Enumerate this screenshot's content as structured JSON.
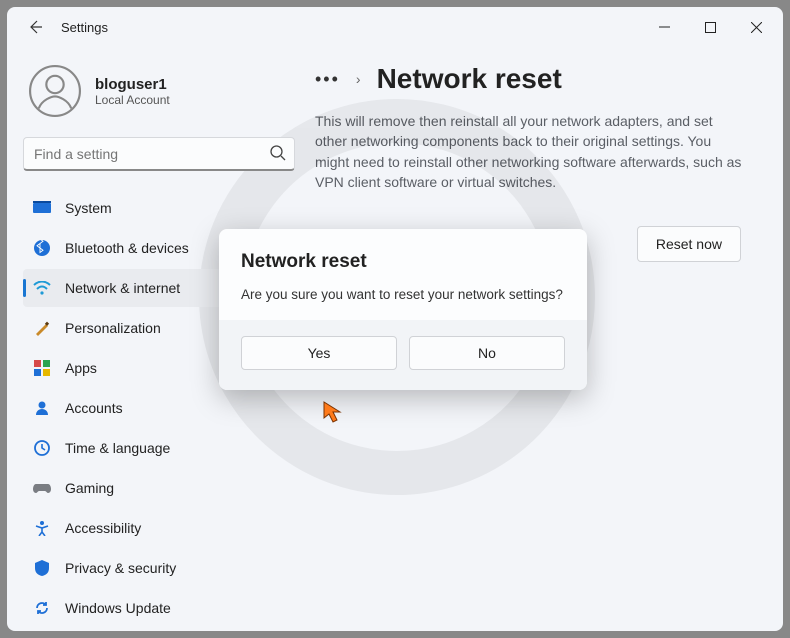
{
  "app_title": "Settings",
  "user": {
    "name": "bloguser1",
    "sub": "Local Account"
  },
  "search": {
    "placeholder": "Find a setting"
  },
  "sidebar": {
    "items": [
      {
        "label": "System"
      },
      {
        "label": "Bluetooth & devices"
      },
      {
        "label": "Network & internet"
      },
      {
        "label": "Personalization"
      },
      {
        "label": "Apps"
      },
      {
        "label": "Accounts"
      },
      {
        "label": "Time & language"
      },
      {
        "label": "Gaming"
      },
      {
        "label": "Accessibility"
      },
      {
        "label": "Privacy & security"
      },
      {
        "label": "Windows Update"
      }
    ],
    "selected_index": 2
  },
  "main": {
    "title": "Network reset",
    "description": "This will remove then reinstall all your network adapters, and set other networking components back to their original settings. You might need to reinstall other networking software afterwards, such as VPN client software or virtual switches.",
    "reset_button": "Reset now"
  },
  "dialog": {
    "title": "Network reset",
    "message": "Are you sure you want to reset your network settings?",
    "yes": "Yes",
    "no": "No"
  },
  "icons": {
    "system_color": "#1e6fd6",
    "bluetooth_color": "#1e6fd6",
    "network_color": "#1e9ad6",
    "personal_color": "#c98a2a",
    "apps_colors": [
      "#d64a4a",
      "#2aa34f",
      "#1e6fd6",
      "#e6b800"
    ],
    "accounts_color": "#1e6fd6",
    "time_color": "#1e6fd6",
    "gaming_color": "#7a7d83",
    "access_color": "#1e6fd6",
    "privacy_color": "#1e6fd6",
    "update_color": "#1e6fd6"
  }
}
